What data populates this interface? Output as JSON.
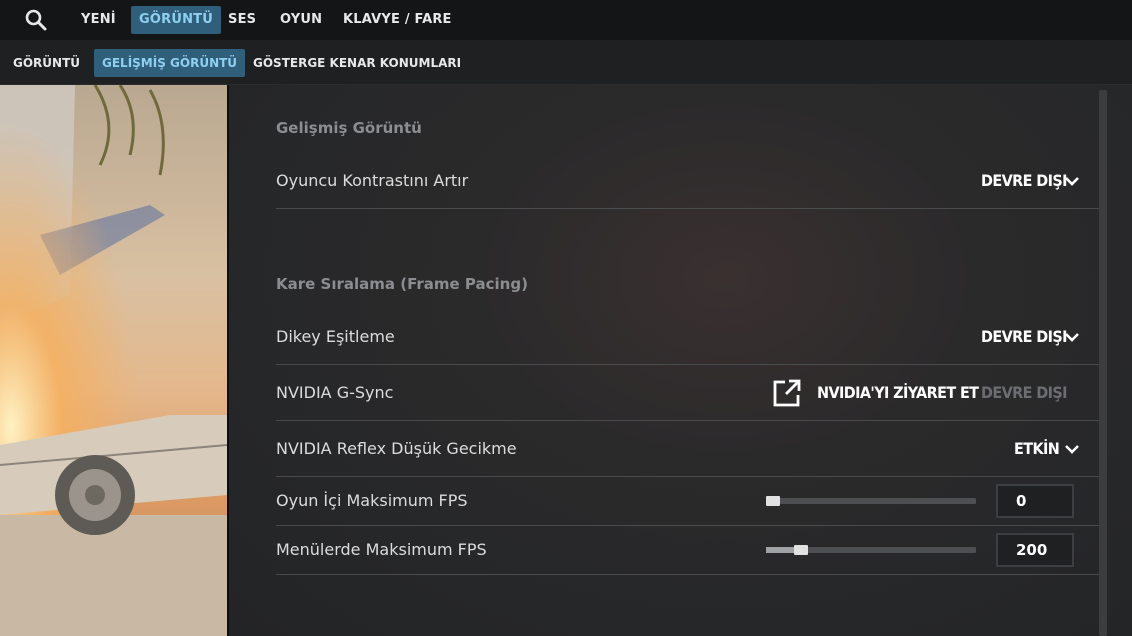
{
  "topnav": {
    "icon": "search-icon",
    "tabs": [
      {
        "label": "YENİ"
      },
      {
        "label": "GÖRÜNTÜ",
        "active": true
      },
      {
        "label": "SES"
      },
      {
        "label": "OYUN"
      },
      {
        "label": "KLAVYE / FARE"
      }
    ]
  },
  "subnav": {
    "tabs": [
      {
        "label": "GÖRÜNTÜ"
      },
      {
        "label": "GELİŞMİŞ GÖRÜNTÜ",
        "active": true
      },
      {
        "label": "GÖSTERGE KENAR KONUMLARI"
      }
    ]
  },
  "colors": {
    "accent_bg": "#2f5f7a",
    "accent_text": "#8fd0f0",
    "panel_bg": "#262729"
  },
  "sections": {
    "advanced": {
      "title": "Gelişmiş Görüntü",
      "player_contrast": {
        "label": "Oyuncu Kontrastını Artır",
        "value": "DEVRE DIŞI"
      }
    },
    "frame_pacing": {
      "title": "Kare Sıralama (Frame Pacing)",
      "vsync": {
        "label": "Dikey Eşitleme",
        "value": "DEVRE DIŞI"
      },
      "gsync": {
        "label": "NVIDIA G-Sync",
        "link": "NVIDIA'YI ZİYARET ET",
        "link_icon": "external-link-icon",
        "value": "DEVRE DIŞI"
      },
      "reflex": {
        "label": "NVIDIA Reflex Düşük Gecikme",
        "value": "ETKİN"
      },
      "max_fps_game": {
        "label": "Oyun İçi Maksimum FPS",
        "value": "0",
        "slider_fraction": 0.0
      },
      "max_fps_menu": {
        "label": "Menülerde Maksimum FPS",
        "value": "200",
        "slider_fraction": 0.17
      }
    }
  }
}
